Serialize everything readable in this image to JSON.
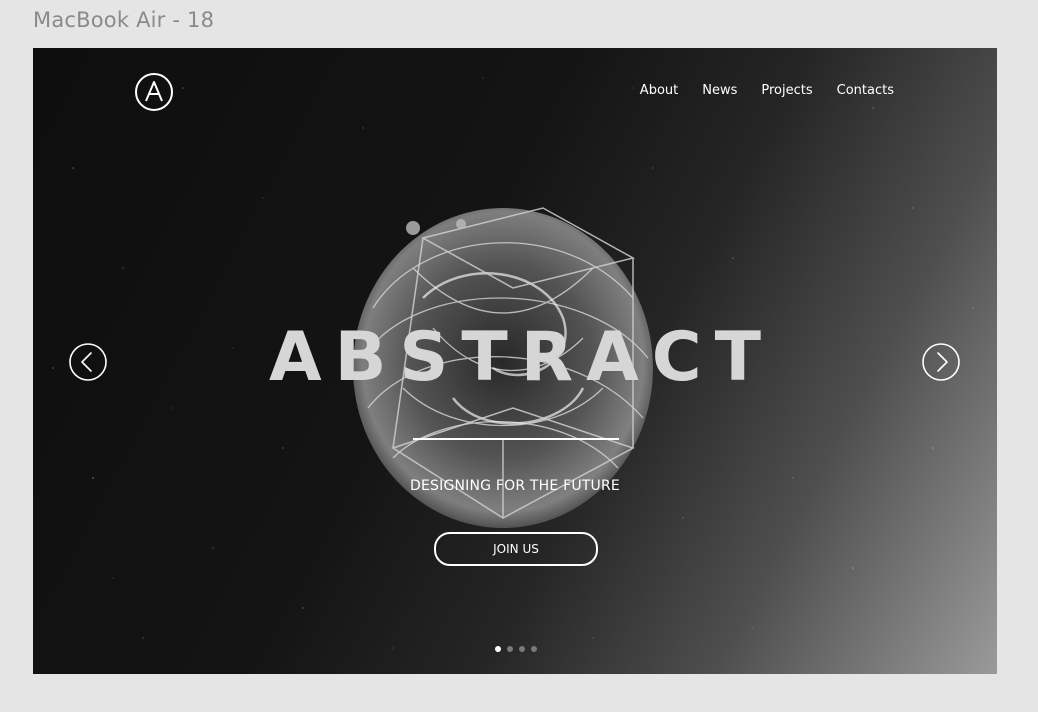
{
  "frame_label": "MacBook Air - 18",
  "logo": {
    "letter": "A"
  },
  "nav": {
    "items": [
      "About",
      "News",
      "Projects",
      "Contacts"
    ]
  },
  "hero": {
    "title": "ABSTRACT",
    "subtitle": "DESIGNING FOR THE FUTURE",
    "cta_label": "JOIN US"
  },
  "carousel": {
    "slide_count": 4,
    "active_index": 0
  },
  "icons": {
    "prev": "chevron-left-circle-icon",
    "next": "chevron-right-circle-icon",
    "logo": "logo-a-circle-icon"
  },
  "colors": {
    "background": "#e5e5e5",
    "hero_dark": "#111111",
    "hero_light": "#9a9a9a",
    "text": "#ffffff",
    "title": "#d6d6d6"
  }
}
